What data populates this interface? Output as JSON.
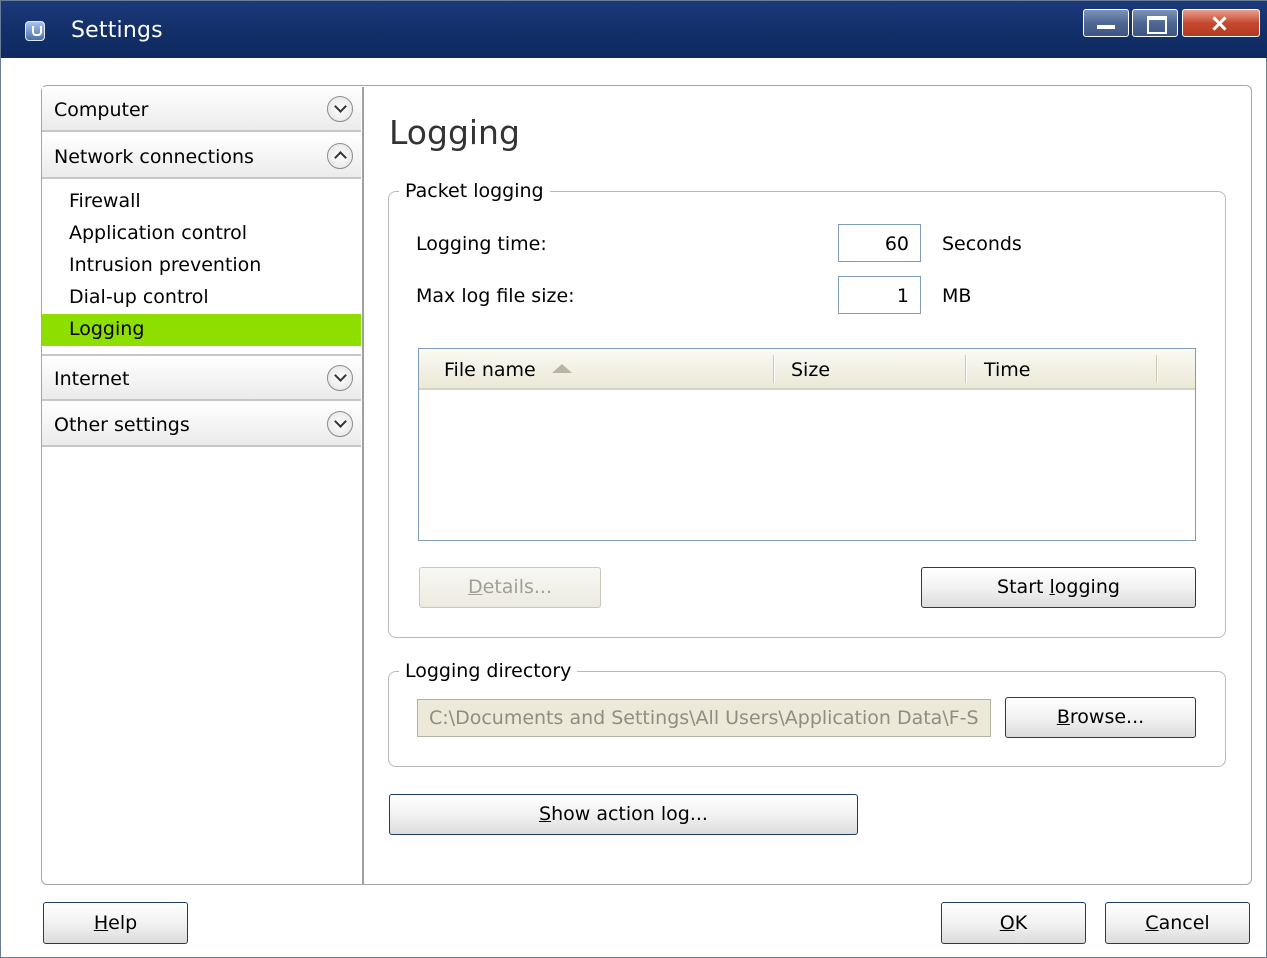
{
  "window": {
    "title": "Settings"
  },
  "nav": {
    "sections": [
      {
        "label": "Computer",
        "state": "collapsed"
      },
      {
        "label": "Network connections",
        "state": "expanded"
      },
      {
        "label": "Internet",
        "state": "collapsed"
      },
      {
        "label": "Other settings",
        "state": "collapsed"
      }
    ],
    "network_items": [
      {
        "label": "Firewall"
      },
      {
        "label": "Application control"
      },
      {
        "label": "Intrusion prevention"
      },
      {
        "label": "Dial-up control"
      },
      {
        "label": "Logging",
        "selected": true
      }
    ],
    "selected_color": "#8ede00"
  },
  "page": {
    "heading": "Logging",
    "packet_logging": {
      "title": "Packet logging",
      "logging_time_label": "Logging time:",
      "logging_time_value": "60",
      "logging_time_unit": "Seconds",
      "max_size_label": "Max log file size:",
      "max_size_value": "1",
      "max_size_unit": "MB",
      "columns": [
        "File name",
        "Size",
        "Time"
      ],
      "sort_column": "File name",
      "sort_direction": "ascending",
      "details_button": {
        "mnemonic": "D",
        "rest": "etails...",
        "enabled": false
      },
      "start_button": {
        "before": "Start ",
        "mnemonic": "l",
        "after": "ogging"
      }
    },
    "logging_directory": {
      "title": "Logging directory",
      "path": "C:\\Documents and Settings\\All Users\\Application Data\\F-S",
      "browse_button": {
        "mnemonic": "B",
        "rest": "rowse..."
      }
    },
    "show_action_log_button": {
      "mnemonic": "S",
      "rest": "how action log..."
    }
  },
  "footer": {
    "help_button": {
      "mnemonic": "H",
      "rest": "elp"
    },
    "ok_button": {
      "mnemonic": "O",
      "rest": "K"
    },
    "cancel_button": {
      "mnemonic": "C",
      "rest": "ancel"
    }
  }
}
